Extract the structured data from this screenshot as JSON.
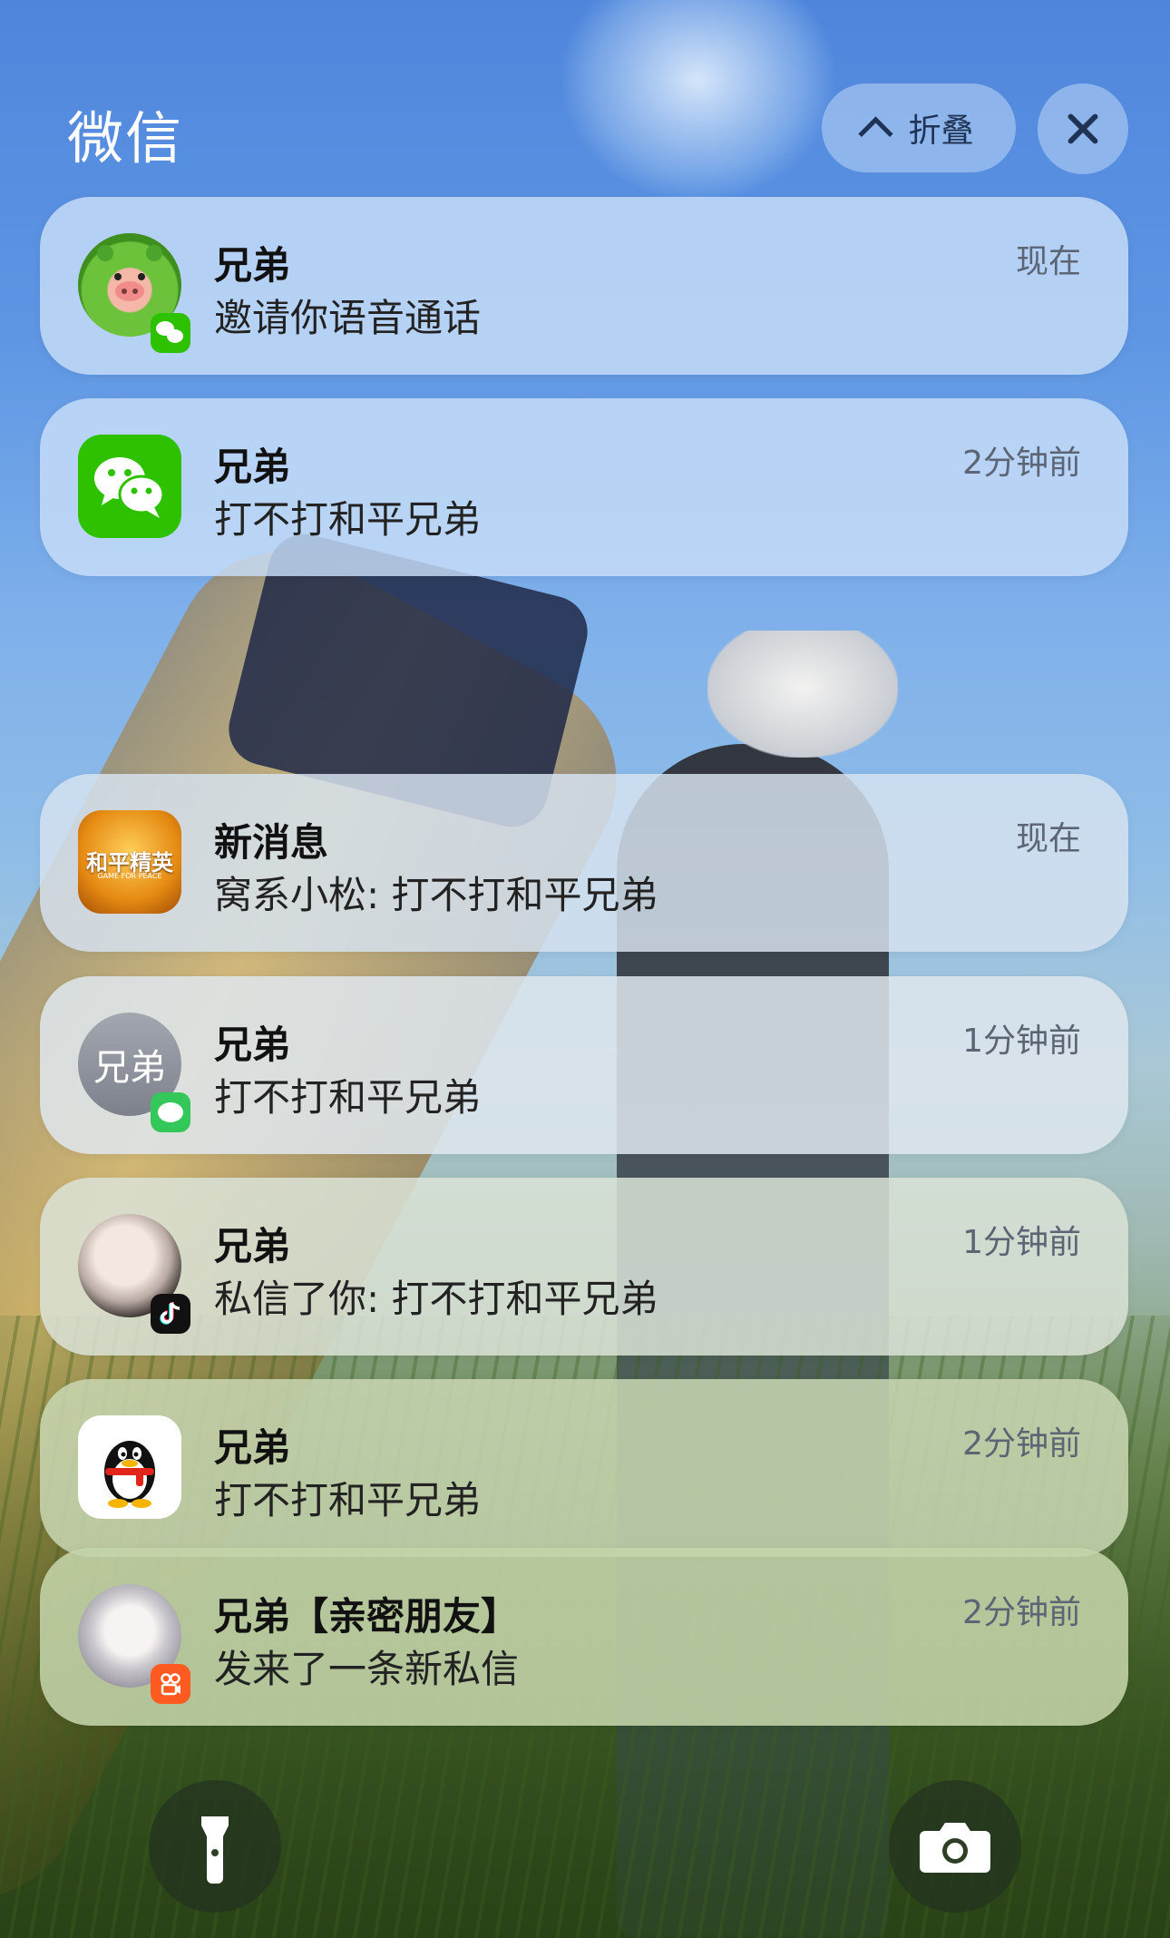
{
  "header": {
    "app_title": "微信",
    "collapse_label": "折叠"
  },
  "notifications": [
    {
      "title": "兄弟",
      "body": "邀请你语音通话",
      "time": "现在"
    },
    {
      "title": "兄弟",
      "body": "打不打和平兄弟",
      "time": "2分钟前"
    },
    {
      "title": "新消息",
      "body": "窝系小松: 打不打和平兄弟",
      "time": "现在",
      "icon_text": "和平精英",
      "icon_subtext": "GAME FOR PEACE"
    },
    {
      "title": "兄弟",
      "body": "打不打和平兄弟",
      "time": "1分钟前",
      "avatar_text": "兄弟"
    },
    {
      "title": "兄弟",
      "body": "私信了你: 打不打和平兄弟",
      "time": "1分钟前"
    },
    {
      "title": "兄弟",
      "body": "打不打和平兄弟",
      "time": "2分钟前"
    },
    {
      "title": "兄弟【亲密朋友】",
      "body": "发来了一条新私信",
      "time": "2分钟前"
    }
  ],
  "icons": {
    "collapse": "chevron-up-icon",
    "close": "close-icon",
    "wechat": "wechat-icon",
    "messages": "messages-icon",
    "tiktok": "tiktok-icon",
    "qq": "qq-penguin-icon",
    "kuaishou": "kuaishou-icon",
    "flashlight": "flashlight-icon",
    "camera": "camera-icon"
  },
  "colors": {
    "wechat_green": "#2dc100",
    "messages_green": "#34c759",
    "tiktok_black": "#111111",
    "kuaishou_orange": "#ff5a1f"
  }
}
